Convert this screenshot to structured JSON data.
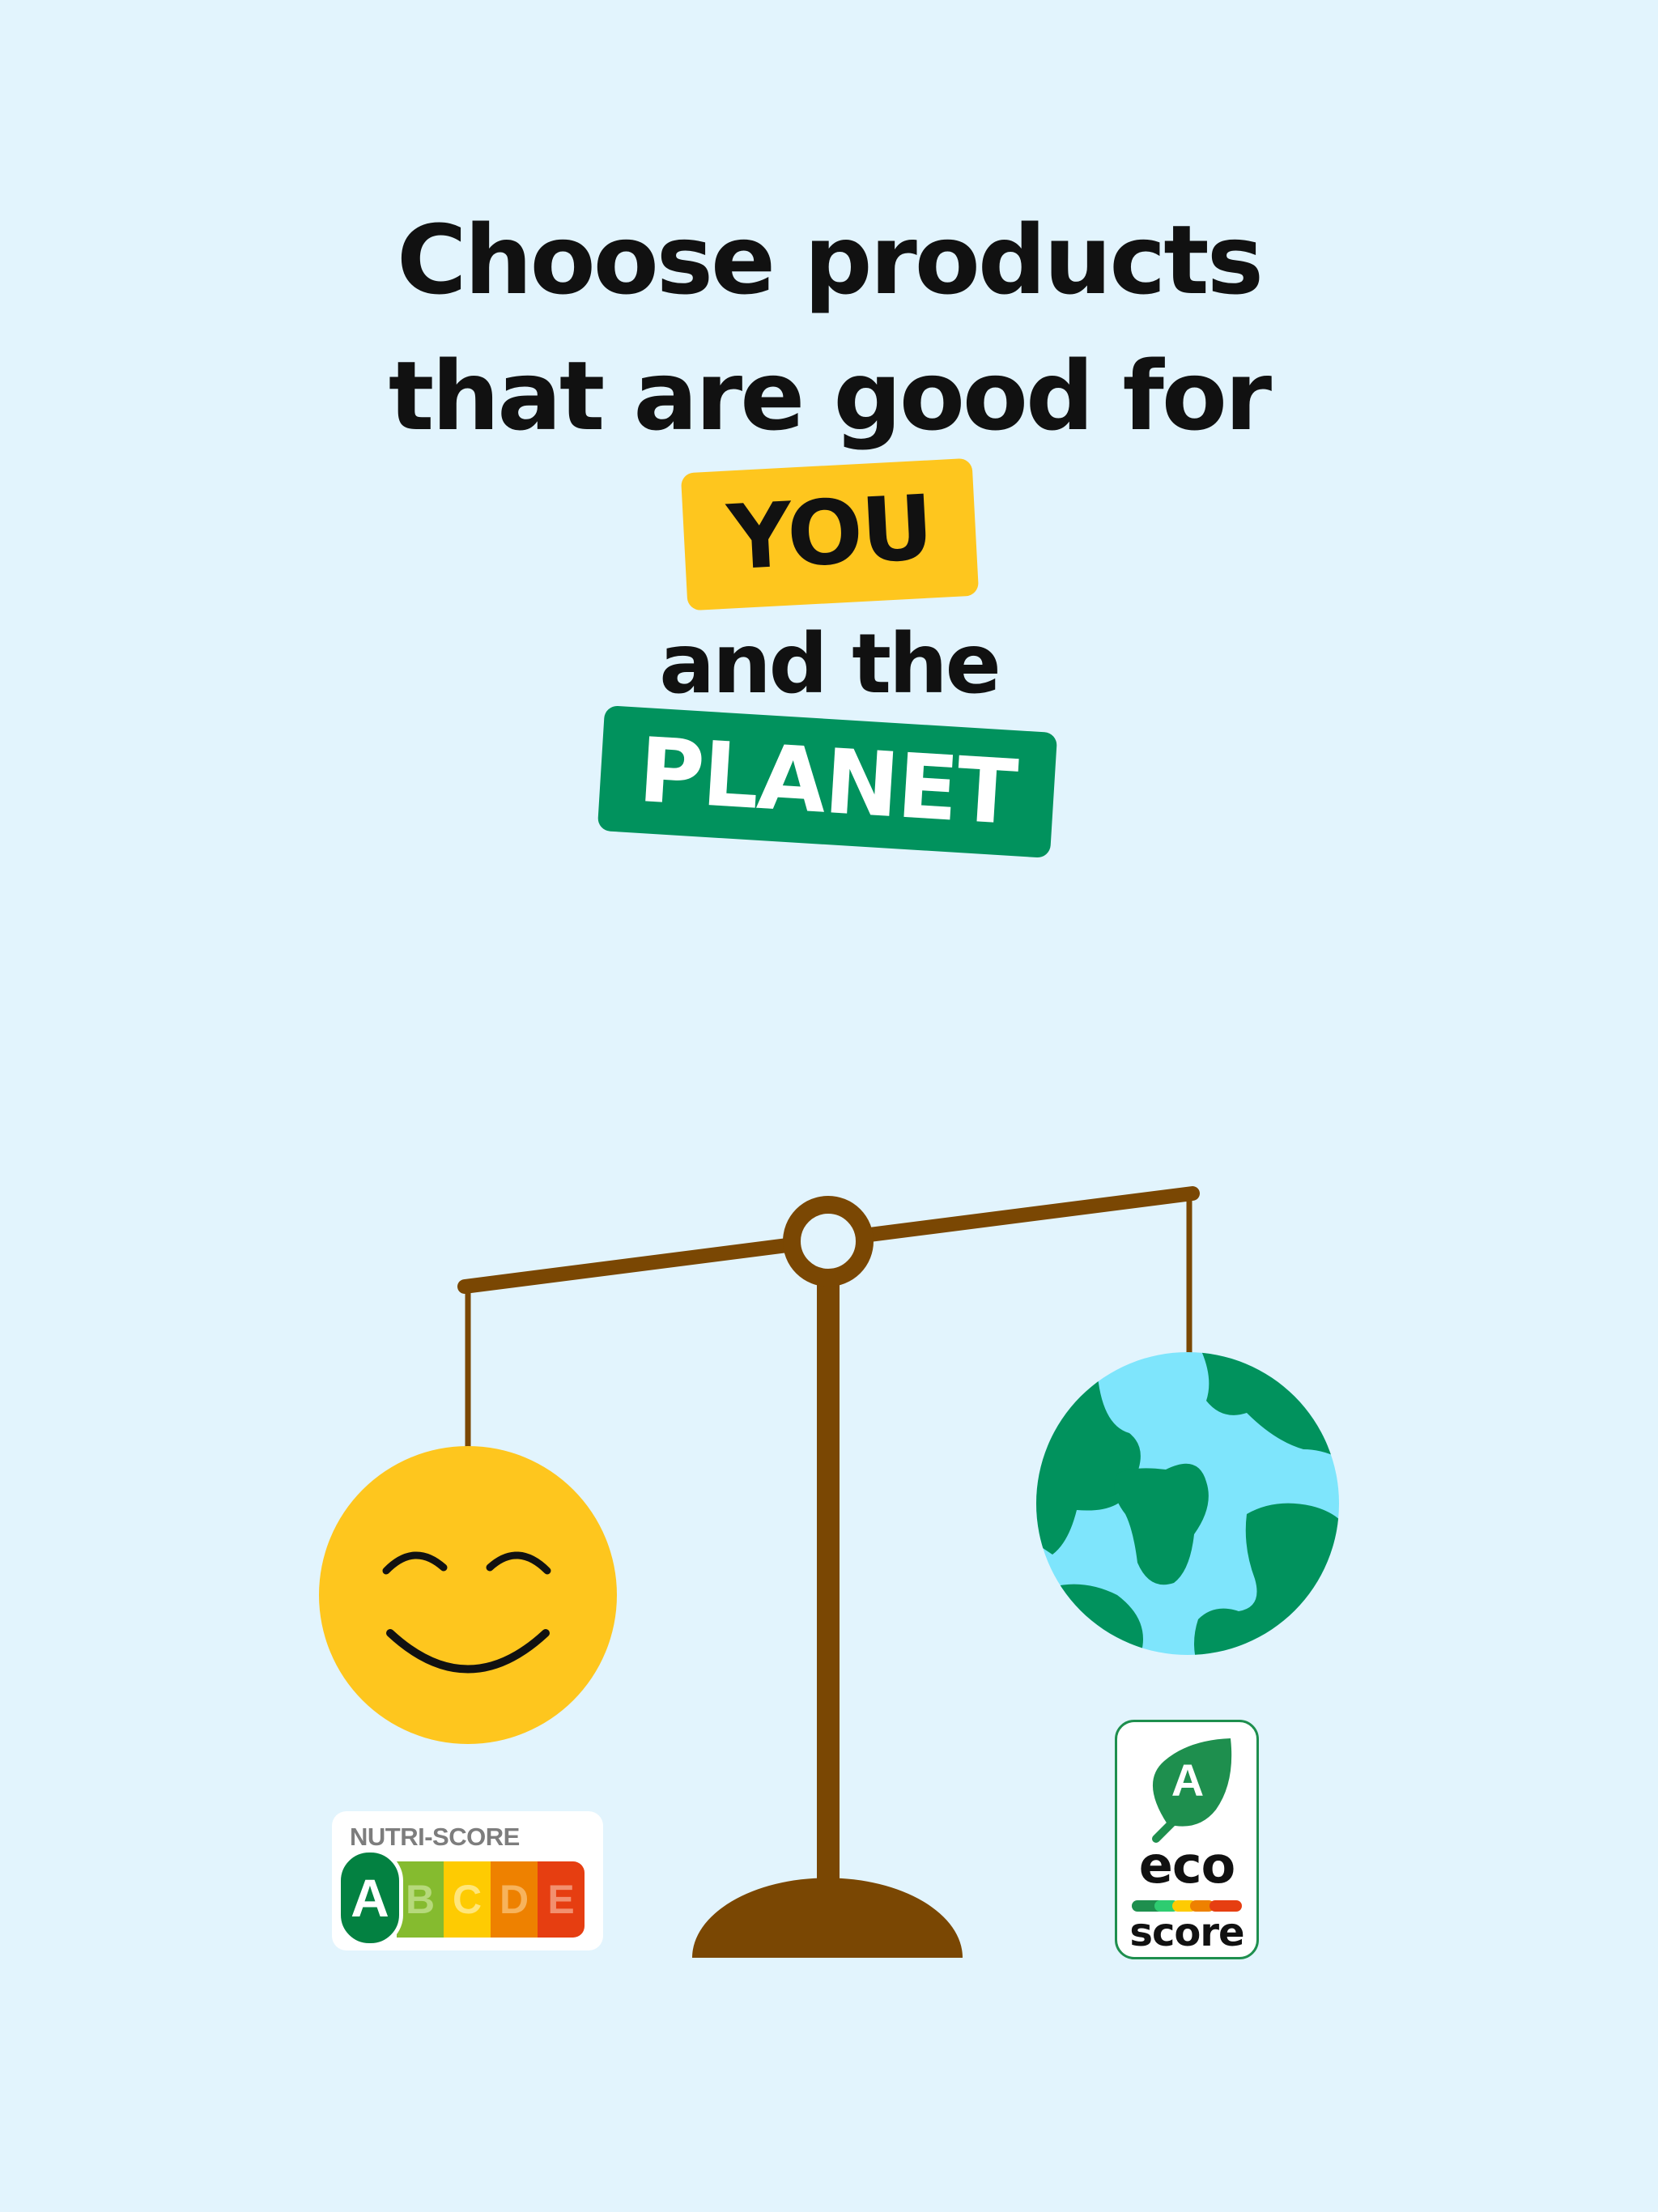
{
  "headline": {
    "line1": "Choose products",
    "line2": "that are good for",
    "you": "YOU",
    "line3": "and the",
    "planet": "PLANET"
  },
  "nutri_score": {
    "title": "NUTRI-SCORE",
    "grades": [
      "A",
      "B",
      "C",
      "D",
      "E"
    ],
    "selected": "A"
  },
  "eco_score": {
    "grade": "A",
    "word1": "eco",
    "word2": "score"
  },
  "illustration": {
    "left_pan": "smiley-face",
    "right_pan": "earth-globe",
    "beam_color": "#7a4703",
    "smiley_color": "#fec61e",
    "ocean_color": "#7ee5fc",
    "land_color": "#01925d"
  }
}
